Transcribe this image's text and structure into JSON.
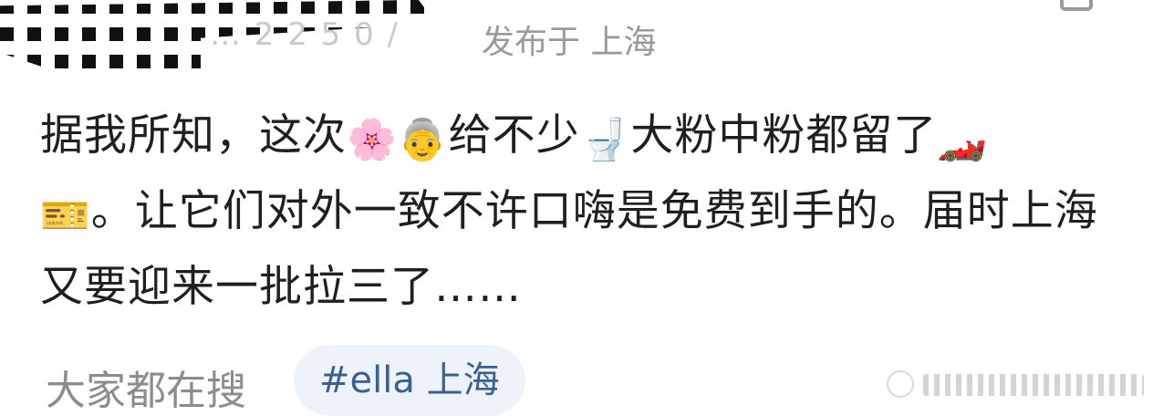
{
  "meta": {
    "time_partial": "… 2 2 5 0 /",
    "published_location": "发布于 上海"
  },
  "post": {
    "text_1": "据我所知，这次",
    "emoji_cherry_blossom": "🌸",
    "emoji_older_woman": "👵",
    "text_2": "给不少",
    "emoji_toilet": "🚽",
    "text_3": "大粉中粉都留了",
    "emoji_racing_car": "🏎️",
    "emoji_ticket": "🎫",
    "text_4": "。让它们对外一致不许口嗨是免费到手的。届时上海又要迎来一批拉三了……"
  },
  "bottom": {
    "search_label": "大家都在搜",
    "hashtag": "#ella 上海"
  },
  "colors": {
    "meta_gray": "#9a9a9a",
    "hashtag_text": "#3a5f94",
    "hashtag_bg": "#eef3f9",
    "body_text": "#1f1f1f"
  },
  "icons": [
    "censor-pattern",
    "cherry-blossom-icon",
    "older-woman-icon",
    "toilet-icon",
    "racing-car-icon",
    "ticket-icon",
    "watermark-logo-icon"
  ]
}
